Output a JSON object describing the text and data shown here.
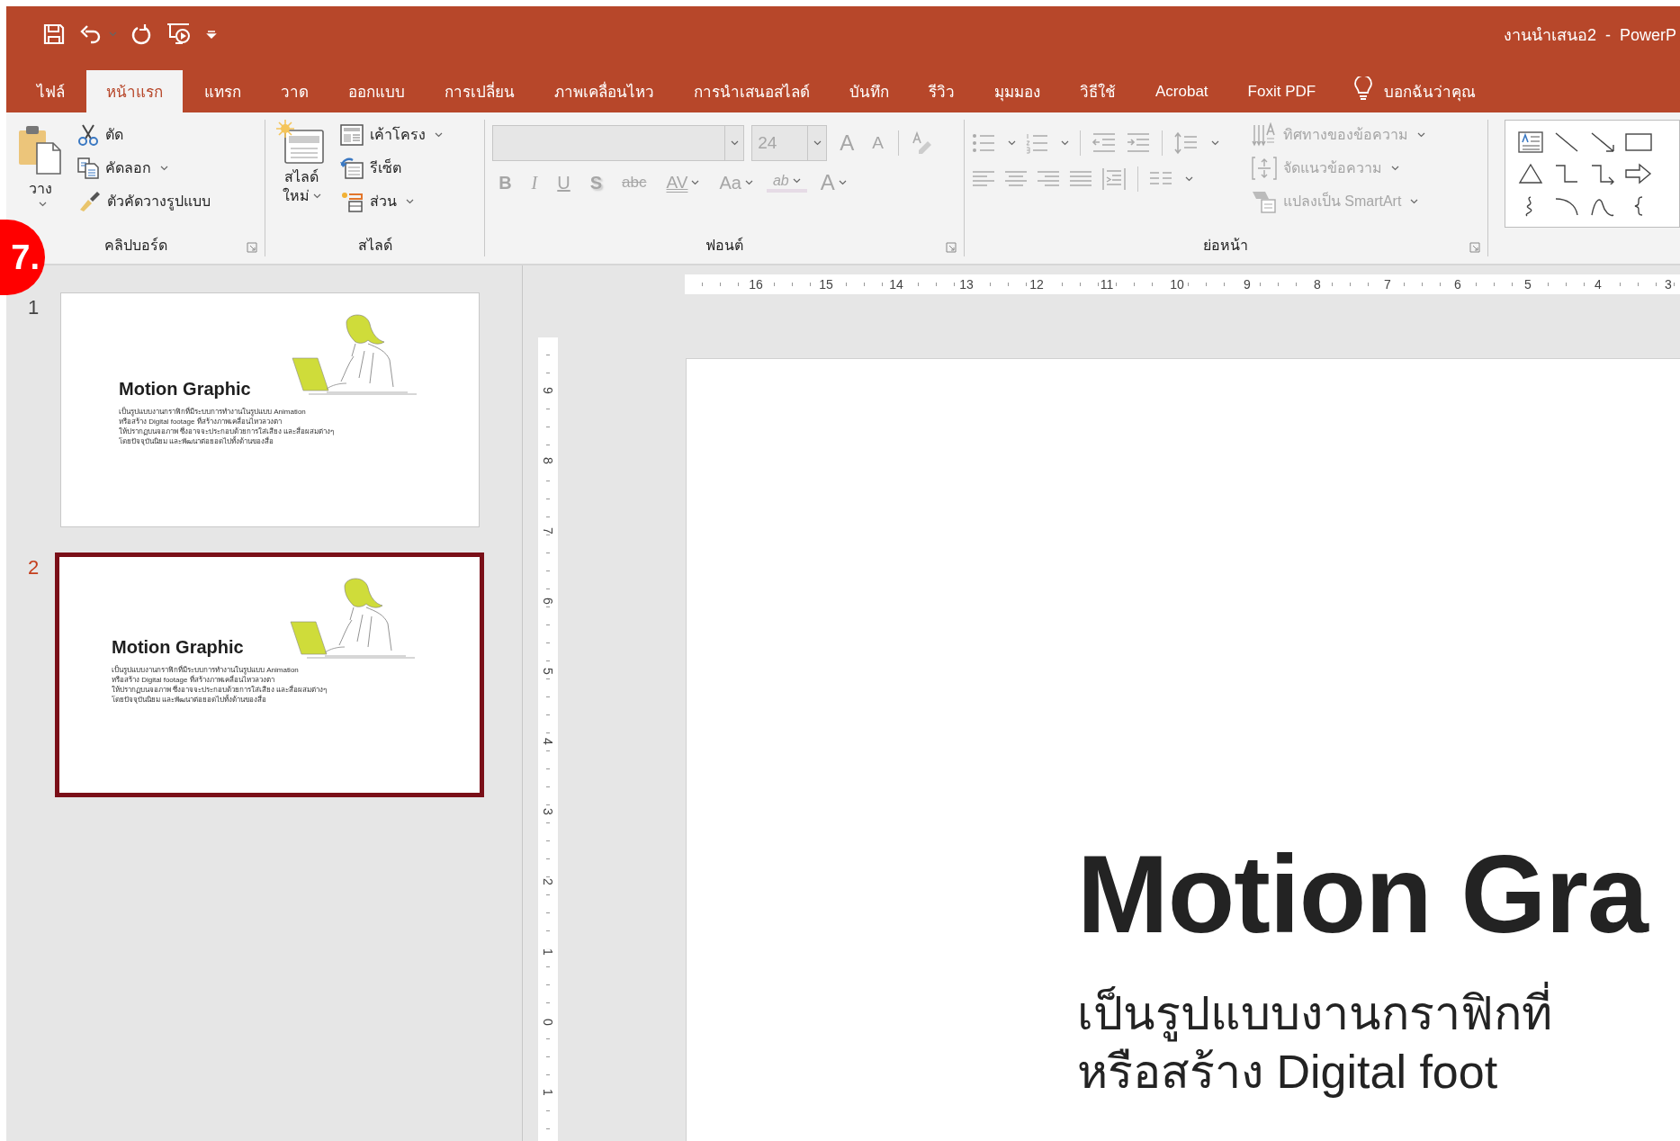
{
  "window": {
    "title": "งานนำเสนอ2  -  PowerP"
  },
  "tabs": [
    {
      "label": "ไฟล์",
      "selected": false
    },
    {
      "label": "หน้าแรก",
      "selected": true
    },
    {
      "label": "แทรก",
      "selected": false
    },
    {
      "label": "วาด",
      "selected": false
    },
    {
      "label": "ออกแบบ",
      "selected": false
    },
    {
      "label": "การเปลี่ยน",
      "selected": false
    },
    {
      "label": "ภาพเคลื่อนไหว",
      "selected": false
    },
    {
      "label": "การนำเสนอสไลด์",
      "selected": false
    },
    {
      "label": "บันทึก",
      "selected": false
    },
    {
      "label": "รีวิว",
      "selected": false
    },
    {
      "label": "มุมมอง",
      "selected": false
    },
    {
      "label": "วิธีใช้",
      "selected": false
    },
    {
      "label": "Acrobat",
      "selected": false
    },
    {
      "label": "Foxit PDF",
      "selected": false
    }
  ],
  "tell_me": "บอกฉันว่าคุณ",
  "clipboard": {
    "label": "คลิปบอร์ด",
    "paste": "วาง",
    "items": [
      {
        "kind": "cut",
        "label": "ตัด",
        "dropdown": false
      },
      {
        "kind": "copy",
        "label": "คัดลอก",
        "dropdown": true
      },
      {
        "kind": "format_painter",
        "label": "ตัวคัดวางรูปแบบ",
        "dropdown": false
      }
    ]
  },
  "slides_group": {
    "label": "สไลด์",
    "new_slide": [
      "สไลด์",
      "ใหม่"
    ],
    "items": [
      {
        "kind": "layout",
        "label": "เค้าโครง",
        "dropdown": true
      },
      {
        "kind": "reset",
        "label": "รีเซ็ต",
        "dropdown": false
      },
      {
        "kind": "section",
        "label": "ส่วน",
        "dropdown": true
      }
    ]
  },
  "font": {
    "label": "ฟอนต์",
    "disabled": true,
    "size": "24",
    "size_buttons": [
      {
        "kind": "grow",
        "glyph": "A"
      },
      {
        "kind": "shrink",
        "glyph": "A"
      }
    ],
    "format_buttons": [
      {
        "kind": "bold",
        "glyph": "B",
        "dropdown": false
      },
      {
        "kind": "italic",
        "glyph": "I",
        "dropdown": false
      },
      {
        "kind": "underline",
        "glyph": "U",
        "dropdown": false
      },
      {
        "kind": "shadow",
        "glyph": "S",
        "dropdown": false
      },
      {
        "kind": "strike",
        "glyph": "abc",
        "dropdown": false
      },
      {
        "kind": "spacing",
        "glyph": "AV",
        "dropdown": true
      },
      {
        "kind": "case",
        "glyph": "Aa",
        "dropdown": true
      },
      {
        "kind": "highlight",
        "glyph": "ab",
        "dropdown": true
      },
      {
        "kind": "color",
        "glyph": "A",
        "dropdown": true
      }
    ]
  },
  "paragraph": {
    "label": "ย่อหน้า",
    "disabled": true,
    "items": [
      {
        "kind": "direction",
        "label": "ทิศทางของข้อความ"
      },
      {
        "kind": "align",
        "label": "จัดแนวข้อความ"
      },
      {
        "kind": "smartart",
        "label": "แปลงเป็น SmartArt"
      }
    ]
  },
  "thumbnails": [
    {
      "number": "1",
      "selected": false,
      "title": "Motion Graphic",
      "body": [
        "เป็นรูปแบบงานกราฟิกที่มีระบบการทำงานในรูปแบบ Animation",
        "หรือสร้าง Digital footage ที่สร้างภาพเคลื่อนไหวลวงตา",
        "ให้ปรากฏบนจอภาพ ซึ่งอาจจะประกอบด้วยการใส่เสียง และสื่อผสมต่างๆ",
        "โดยปัจจุบันนิยม และพัฒนาต่อยอดไปทั้งด้านของสื่อ"
      ]
    },
    {
      "number": "2",
      "selected": true,
      "title": "Motion Graphic",
      "body": [
        "เป็นรูปแบบงานกราฟิกที่มีระบบการทำงานในรูปแบบ Animation",
        "หรือสร้าง Digital footage ที่สร้างภาพเคลื่อนไหวลวงตา",
        "ให้ปรากฏบนจอภาพ ซึ่งอาจจะประกอบด้วยการใส่เสียง และสื่อผสมต่างๆ",
        "โดยปัจจุบันนิยม และพัฒนาต่อยอดไปทั้งด้านของสื่อ"
      ]
    }
  ],
  "rulers": {
    "horizontal": [
      "16",
      "15",
      "14",
      "13",
      "12",
      "11",
      "10",
      "9",
      "8",
      "7",
      "6",
      "5",
      "4",
      "3"
    ],
    "vertical": [
      "9",
      "8",
      "7",
      "6",
      "5",
      "4",
      "3",
      "2",
      "1",
      "0",
      "1"
    ]
  },
  "editor": {
    "title": "Motion Gra",
    "body": [
      "เป็นรูปแบบงานกราฟิกที่",
      "หรือสร้าง Digital foot"
    ]
  },
  "step_badge": "7."
}
